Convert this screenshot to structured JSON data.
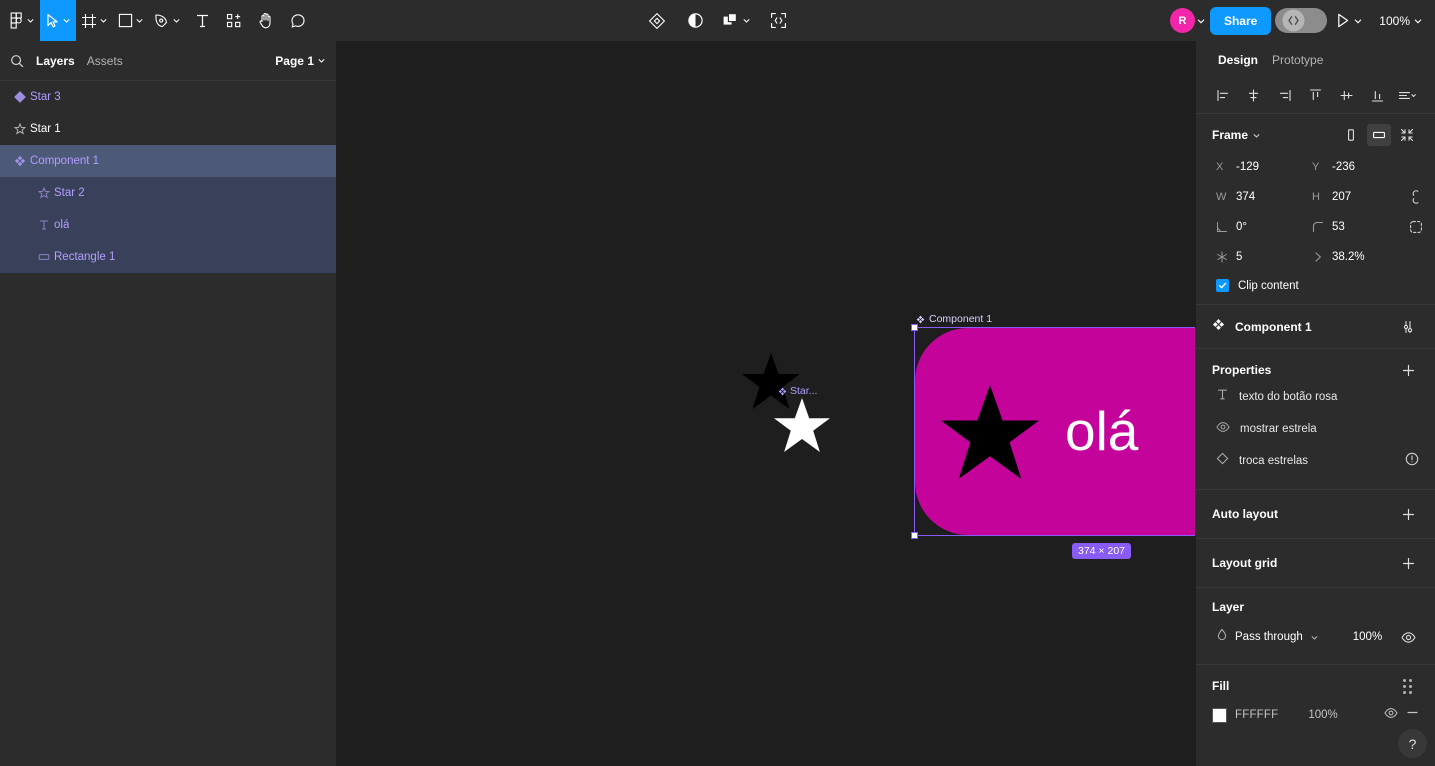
{
  "toolbar": {
    "left_tools": [
      {
        "name": "figma-menu",
        "icon": "figma-logo",
        "caret": true,
        "active": false
      },
      {
        "name": "move-tool",
        "icon": "cursor-arrow",
        "caret": true,
        "active": true
      },
      {
        "name": "frame-tool",
        "icon": "frame",
        "caret": true,
        "active": false
      },
      {
        "name": "shape-tool",
        "icon": "square",
        "caret": true,
        "active": false
      },
      {
        "name": "pen-tool",
        "icon": "pen",
        "caret": true,
        "active": false
      },
      {
        "name": "text-tool",
        "icon": "text-T",
        "caret": false,
        "active": false
      },
      {
        "name": "actions-tool",
        "icon": "resources",
        "caret": false,
        "active": false
      },
      {
        "name": "hand-tool",
        "icon": "hand",
        "caret": false,
        "active": false
      },
      {
        "name": "comment-tool",
        "icon": "comment-bubble",
        "caret": false,
        "active": false
      }
    ],
    "center_tools": [
      {
        "name": "component-tool",
        "icon": "component-diamond"
      },
      {
        "name": "mask-tool",
        "icon": "half-circle"
      },
      {
        "name": "boolean-tool",
        "icon": "union-squares",
        "caret": true
      },
      {
        "name": "dev-resources-tool",
        "icon": "code-brackets"
      }
    ],
    "avatar_initial": "R",
    "share_label": "Share",
    "zoom_level": "100%"
  },
  "left_panel": {
    "search_icon": "search-icon",
    "tabs": [
      {
        "label": "Layers",
        "active": true
      },
      {
        "label": "Assets",
        "active": false
      }
    ],
    "page_selector": "Page 1",
    "layers": [
      {
        "label": "Star 3",
        "icon": "component-icon",
        "depth": 0,
        "color": "component",
        "state": "normal"
      },
      {
        "label": "Star 1",
        "icon": "star-icon",
        "depth": 0,
        "color": "white",
        "state": "normal"
      },
      {
        "label": "Component 1",
        "icon": "component-icon",
        "depth": 0,
        "color": "component",
        "state": "selected"
      },
      {
        "label": "Star 2",
        "icon": "star-icon",
        "depth": 1,
        "color": "component",
        "state": "child-selected"
      },
      {
        "label": "olá",
        "icon": "text-icon",
        "depth": 1,
        "color": "component",
        "state": "child-selected"
      },
      {
        "label": "Rectangle 1",
        "icon": "rectangle-icon",
        "depth": 1,
        "color": "component",
        "state": "child-selected"
      }
    ]
  },
  "canvas": {
    "selection_label": "Component 1",
    "star_group_label": "Star...",
    "component_text": "olá",
    "size_badge": "374 × 207",
    "component_fill": "#C4039B",
    "selection_color": "#8A5CF6"
  },
  "right_panel": {
    "tabs": [
      {
        "label": "Design",
        "active": true
      },
      {
        "label": "Prototype",
        "active": false
      }
    ],
    "align_buttons": [
      "align-left-icon",
      "align-horizontal-center-icon",
      "align-right-icon",
      "align-top-icon",
      "align-vertical-center-icon",
      "align-bottom-icon",
      "distribute-icon"
    ],
    "frame": {
      "title": "Frame",
      "mode_icons": [
        "portrait-frame-icon",
        "landscape-frame-icon",
        "collapse-icon"
      ],
      "fields": [
        {
          "label": "X",
          "value": "-129",
          "name": "x-field"
        },
        {
          "label": "Y",
          "value": "-236",
          "name": "y-field"
        },
        {
          "label": "W",
          "value": "374",
          "name": "width-field"
        },
        {
          "label": "H",
          "value": "207",
          "name": "height-field"
        },
        {
          "label": "rotation",
          "value": "0°",
          "name": "rotation-field"
        },
        {
          "label": "corner-radius",
          "value": "53",
          "name": "corner-radius-field"
        },
        {
          "label": "star-points",
          "value": "5",
          "name": "star-points-field"
        },
        {
          "label": "star-ratio",
          "value": "38.2%",
          "name": "star-ratio-field"
        }
      ],
      "constrain_icon": "constrain-proportions-icon",
      "independent_corners_icon": "independent-corners-icon",
      "clip_content_label": "Clip content",
      "clip_content_checked": true
    },
    "component": {
      "name": "Component 1",
      "icon": "component-icon",
      "action_icon": "component-settings-icon"
    },
    "properties": {
      "title": "Properties",
      "add_icon": "plus-icon",
      "items": [
        {
          "label": "texto do botão rosa",
          "icon": "text-property-icon",
          "warning": false
        },
        {
          "label": "mostrar estrela",
          "icon": "boolean-eye-icon",
          "warning": false
        },
        {
          "label": "troca estrelas",
          "icon": "instance-swap-icon",
          "warning": true
        }
      ]
    },
    "auto_layout": {
      "title": "Auto layout",
      "add_icon": "plus-icon"
    },
    "layout_grid": {
      "title": "Layout grid",
      "add_icon": "plus-icon"
    },
    "layer": {
      "title": "Layer",
      "blend_mode": "Pass through",
      "blend_icon": "blend-drop-icon",
      "opacity": "100%",
      "visibility_icon": "eye-icon"
    },
    "fill": {
      "title": "Fill",
      "styles_icon": "styles-grid-icon",
      "color_hex": "FFFFFF",
      "opacity": "100%",
      "visibility_icon": "eye-icon",
      "remove_icon": "minus-icon"
    },
    "help_label": "?"
  }
}
